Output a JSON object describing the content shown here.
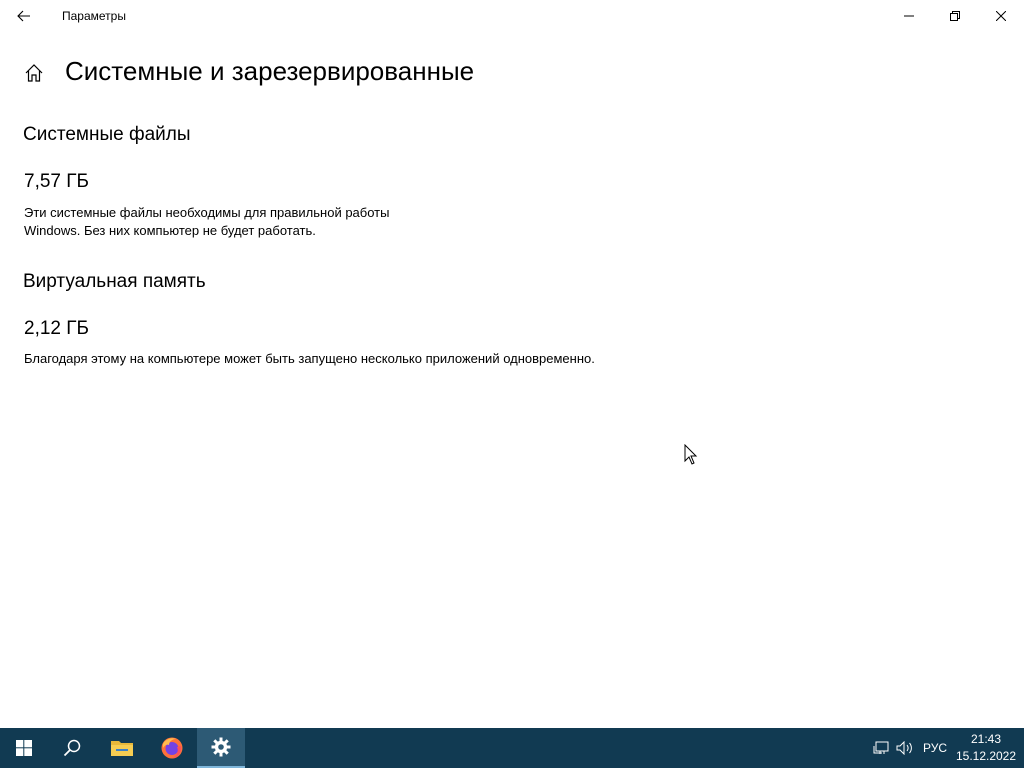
{
  "window": {
    "title": "Параметры"
  },
  "page": {
    "title": "Системные и зарезервированные"
  },
  "sections": [
    {
      "title": "Системные файлы",
      "size": "7,57 ГБ",
      "description_line1": "Эти системные файлы необходимы для правильной работы",
      "description_line2": "Windows. Без них компьютер не будет работать."
    },
    {
      "title": "Виртуальная память",
      "size": "2,12 ГБ",
      "description_line1": "Благодаря этому на компьютере может быть запущено несколько приложений одновременно."
    }
  ],
  "taskbar": {
    "apps": [
      {
        "name": "start",
        "icon": "windows-logo-icon"
      },
      {
        "name": "search",
        "icon": "search-icon"
      },
      {
        "name": "file-explorer",
        "icon": "folder-icon"
      },
      {
        "name": "firefox",
        "icon": "firefox-icon"
      },
      {
        "name": "settings",
        "icon": "gear-icon",
        "active": true
      }
    ],
    "tray": {
      "language": "РУС",
      "time": "21:43",
      "date": "15.12.2022"
    },
    "background": "#113a52"
  }
}
